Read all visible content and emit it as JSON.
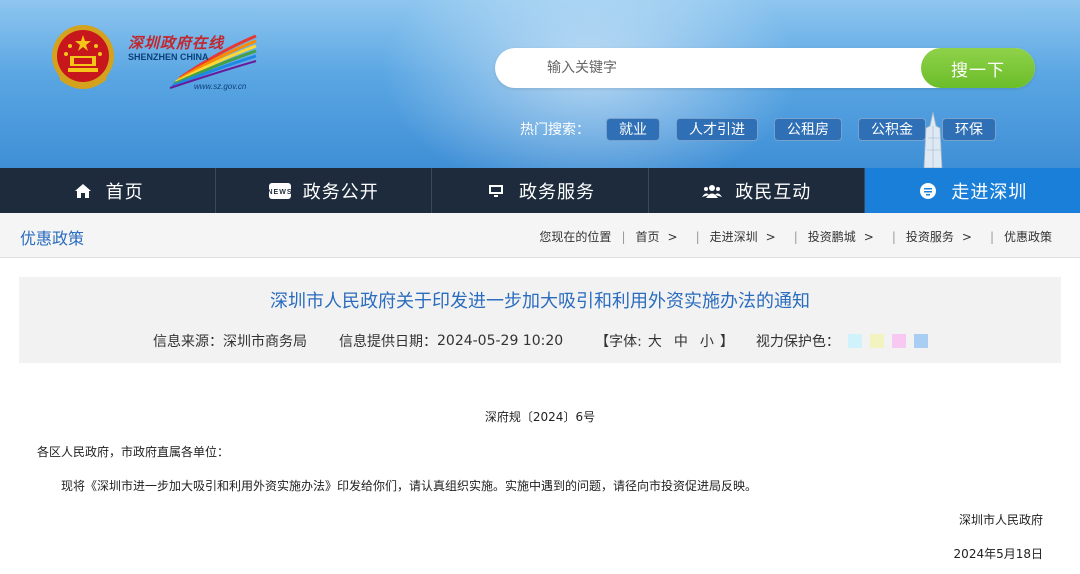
{
  "header": {
    "logo_cn": "深圳政府在线",
    "logo_en": "SHENZHEN CHINA",
    "logo_url": "www.sz.gov.cn",
    "search": {
      "placeholder": "输入关键字",
      "button": "搜一下"
    },
    "hot": {
      "label": "热门搜索：",
      "tags": [
        "就业",
        "人才引进",
        "公租房",
        "公积金",
        "环保"
      ]
    }
  },
  "nav": [
    {
      "label": "首页",
      "icon": "home-icon"
    },
    {
      "label": "政务公开",
      "icon": "news-icon"
    },
    {
      "label": "政务服务",
      "icon": "monitor-icon"
    },
    {
      "label": "政民互动",
      "icon": "people-icon"
    },
    {
      "label": "走进深圳",
      "icon": "info-bubble-icon",
      "active": true
    }
  ],
  "breadcrumb": {
    "section_title": "优惠政策",
    "location_label": "您现在的位置",
    "items": [
      "首页",
      "走进深圳",
      "投资鹏城",
      "投资服务",
      "优惠政策"
    ]
  },
  "article": {
    "title": "深圳市人民政府关于印发进一步加大吸引和利用外资实施办法的通知",
    "source_label": "信息来源：",
    "source": "深圳市商务局",
    "date_label": "信息提供日期：",
    "date": "2024-05-29 10:20",
    "font_open": "【字体:",
    "font_large": "大",
    "font_medium": "中",
    "font_small": "小",
    "font_close": "】",
    "eye_label": "视力保护色：",
    "eye_colors": [
      "#cff2fb",
      "#f3f3c0",
      "#f7c8f2",
      "#a9cdf3"
    ],
    "doc_no": "深府规〔2024〕6号",
    "salutation": "各区人民政府，市政府直属各单位：",
    "body": "现将《深圳市进一步加大吸引和利用外资实施办法》印发给你们，请认真组织实施。实施中遇到的问题，请径向市投资促进局反映。",
    "signature": "深圳市人民政府",
    "sign_date": "2024年5月18日"
  },
  "colors": {
    "nav_bg": "#1d2b3c",
    "nav_active": "#1a7fd8",
    "title_blue": "#2a6cbf",
    "search_green": "#6bbd2a",
    "hot_tag": "#2f6fb6"
  }
}
